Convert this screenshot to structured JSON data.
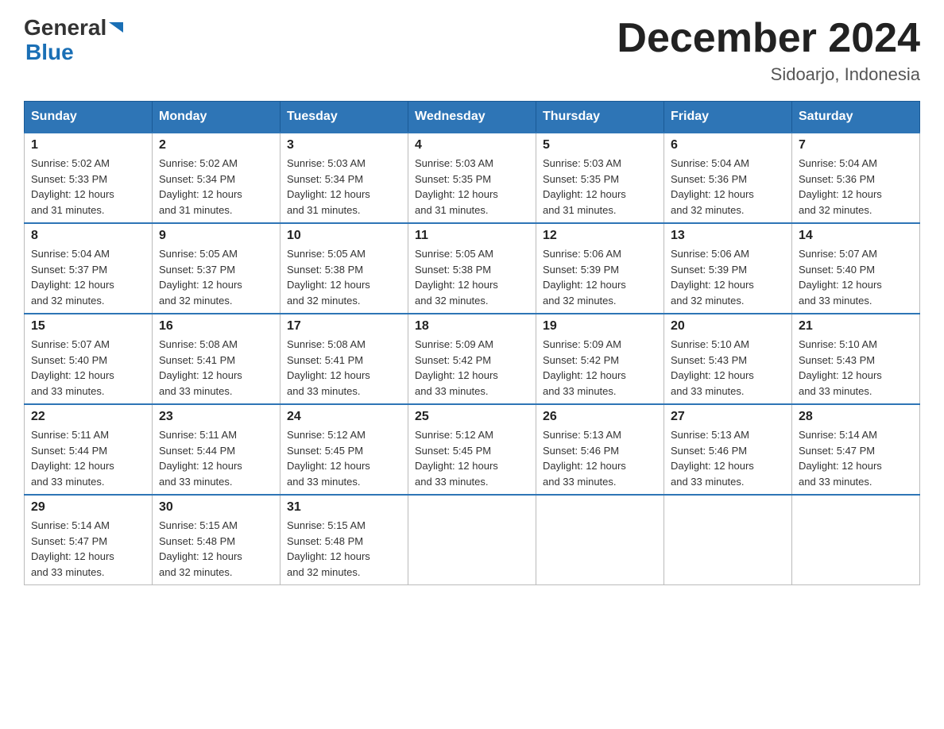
{
  "header": {
    "logo_general": "General",
    "logo_blue": "Blue",
    "month_title": "December 2024",
    "location": "Sidoarjo, Indonesia"
  },
  "days_of_week": [
    "Sunday",
    "Monday",
    "Tuesday",
    "Wednesday",
    "Thursday",
    "Friday",
    "Saturday"
  ],
  "weeks": [
    [
      {
        "day": "1",
        "sunrise": "5:02 AM",
        "sunset": "5:33 PM",
        "daylight": "12 hours and 31 minutes."
      },
      {
        "day": "2",
        "sunrise": "5:02 AM",
        "sunset": "5:34 PM",
        "daylight": "12 hours and 31 minutes."
      },
      {
        "day": "3",
        "sunrise": "5:03 AM",
        "sunset": "5:34 PM",
        "daylight": "12 hours and 31 minutes."
      },
      {
        "day": "4",
        "sunrise": "5:03 AM",
        "sunset": "5:35 PM",
        "daylight": "12 hours and 31 minutes."
      },
      {
        "day": "5",
        "sunrise": "5:03 AM",
        "sunset": "5:35 PM",
        "daylight": "12 hours and 31 minutes."
      },
      {
        "day": "6",
        "sunrise": "5:04 AM",
        "sunset": "5:36 PM",
        "daylight": "12 hours and 32 minutes."
      },
      {
        "day": "7",
        "sunrise": "5:04 AM",
        "sunset": "5:36 PM",
        "daylight": "12 hours and 32 minutes."
      }
    ],
    [
      {
        "day": "8",
        "sunrise": "5:04 AM",
        "sunset": "5:37 PM",
        "daylight": "12 hours and 32 minutes."
      },
      {
        "day": "9",
        "sunrise": "5:05 AM",
        "sunset": "5:37 PM",
        "daylight": "12 hours and 32 minutes."
      },
      {
        "day": "10",
        "sunrise": "5:05 AM",
        "sunset": "5:38 PM",
        "daylight": "12 hours and 32 minutes."
      },
      {
        "day": "11",
        "sunrise": "5:05 AM",
        "sunset": "5:38 PM",
        "daylight": "12 hours and 32 minutes."
      },
      {
        "day": "12",
        "sunrise": "5:06 AM",
        "sunset": "5:39 PM",
        "daylight": "12 hours and 32 minutes."
      },
      {
        "day": "13",
        "sunrise": "5:06 AM",
        "sunset": "5:39 PM",
        "daylight": "12 hours and 32 minutes."
      },
      {
        "day": "14",
        "sunrise": "5:07 AM",
        "sunset": "5:40 PM",
        "daylight": "12 hours and 33 minutes."
      }
    ],
    [
      {
        "day": "15",
        "sunrise": "5:07 AM",
        "sunset": "5:40 PM",
        "daylight": "12 hours and 33 minutes."
      },
      {
        "day": "16",
        "sunrise": "5:08 AM",
        "sunset": "5:41 PM",
        "daylight": "12 hours and 33 minutes."
      },
      {
        "day": "17",
        "sunrise": "5:08 AM",
        "sunset": "5:41 PM",
        "daylight": "12 hours and 33 minutes."
      },
      {
        "day": "18",
        "sunrise": "5:09 AM",
        "sunset": "5:42 PM",
        "daylight": "12 hours and 33 minutes."
      },
      {
        "day": "19",
        "sunrise": "5:09 AM",
        "sunset": "5:42 PM",
        "daylight": "12 hours and 33 minutes."
      },
      {
        "day": "20",
        "sunrise": "5:10 AM",
        "sunset": "5:43 PM",
        "daylight": "12 hours and 33 minutes."
      },
      {
        "day": "21",
        "sunrise": "5:10 AM",
        "sunset": "5:43 PM",
        "daylight": "12 hours and 33 minutes."
      }
    ],
    [
      {
        "day": "22",
        "sunrise": "5:11 AM",
        "sunset": "5:44 PM",
        "daylight": "12 hours and 33 minutes."
      },
      {
        "day": "23",
        "sunrise": "5:11 AM",
        "sunset": "5:44 PM",
        "daylight": "12 hours and 33 minutes."
      },
      {
        "day": "24",
        "sunrise": "5:12 AM",
        "sunset": "5:45 PM",
        "daylight": "12 hours and 33 minutes."
      },
      {
        "day": "25",
        "sunrise": "5:12 AM",
        "sunset": "5:45 PM",
        "daylight": "12 hours and 33 minutes."
      },
      {
        "day": "26",
        "sunrise": "5:13 AM",
        "sunset": "5:46 PM",
        "daylight": "12 hours and 33 minutes."
      },
      {
        "day": "27",
        "sunrise": "5:13 AM",
        "sunset": "5:46 PM",
        "daylight": "12 hours and 33 minutes."
      },
      {
        "day": "28",
        "sunrise": "5:14 AM",
        "sunset": "5:47 PM",
        "daylight": "12 hours and 33 minutes."
      }
    ],
    [
      {
        "day": "29",
        "sunrise": "5:14 AM",
        "sunset": "5:47 PM",
        "daylight": "12 hours and 33 minutes."
      },
      {
        "day": "30",
        "sunrise": "5:15 AM",
        "sunset": "5:48 PM",
        "daylight": "12 hours and 32 minutes."
      },
      {
        "day": "31",
        "sunrise": "5:15 AM",
        "sunset": "5:48 PM",
        "daylight": "12 hours and 32 minutes."
      },
      null,
      null,
      null,
      null
    ]
  ],
  "labels": {
    "sunrise_prefix": "Sunrise: ",
    "sunset_prefix": "Sunset: ",
    "daylight_prefix": "Daylight: "
  }
}
